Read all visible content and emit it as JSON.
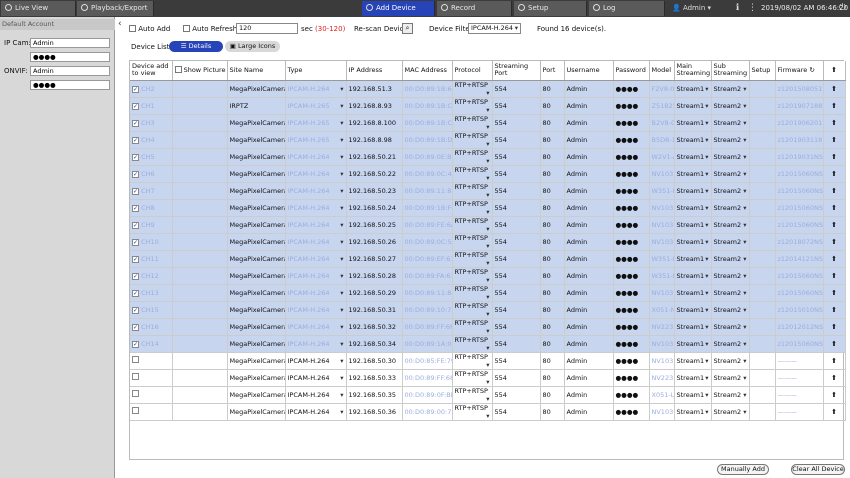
{
  "topbar": {
    "tabs": [
      {
        "label": "Live View",
        "icon": "monitor-icon"
      },
      {
        "label": "Playback/Export",
        "icon": "play-icon"
      },
      {
        "label": "Add Device",
        "icon": "plus-icon"
      },
      {
        "label": "Record",
        "icon": "record-icon"
      },
      {
        "label": "Setup",
        "icon": "gear-icon"
      },
      {
        "label": "Log",
        "icon": "log-icon"
      }
    ],
    "user": "Admin",
    "datetime": "2019/08/02 AM 06:46:20"
  },
  "sidebar": {
    "title": "Default Account",
    "ip_cam_label": "IP Cam:",
    "ip_cam_user": "Admin",
    "ip_cam_pass": "●●●●",
    "onvif_label": "ONVIF:",
    "onvif_user": "Admin",
    "onvif_pass": "●●●●"
  },
  "toolbar": {
    "auto_add": "Auto Add",
    "auto_refresh": "Auto Refresh",
    "refresh_value": "120",
    "refresh_unit": "sec",
    "refresh_range": "(30-120)",
    "rescan": "Re-scan Device",
    "device_filter_label": "Device Filter",
    "device_filter_value": "IPCAM-H.264",
    "found": "Found 16 device(s).",
    "device_list": "Device List",
    "details": "Details",
    "large_icons": "Large Icons"
  },
  "columns": [
    "Device add to view",
    "Show Picture",
    "Site Name",
    "Type",
    "IP Address",
    "MAC Address",
    "Protocol",
    "Streaming Port",
    "Port",
    "Username",
    "Password",
    "Model",
    "Main Streaming",
    "Sub Streaming",
    "Setup",
    "Firmware"
  ],
  "rows": [
    {
      "sel": true,
      "ch": "CH2",
      "site": "MegaPixelCamera",
      "type": "IPCAM-H.264",
      "ip": "192.168.51.3",
      "mac": "00:D0:89:1B:6E:0F",
      "proto": "RTP+RTSP",
      "sport": "554",
      "port": "80",
      "user": "Admin",
      "pass": "●●●●",
      "model": "F2V8-0",
      "main": "Stream1",
      "sub": "Stream2",
      "fw": "z12015080512"
    },
    {
      "sel": true,
      "ch": "CH1",
      "site": "IRPTZ",
      "type": "IPCAM-H.265",
      "ip": "192.168.8.93",
      "mac": "00:D0:89:1B:C6:15",
      "proto": "RTP+RTSP",
      "sport": "554",
      "port": "80",
      "user": "Admin",
      "pass": "●●●●",
      "model": "Z51B251",
      "main": "Stream1",
      "sub": "Stream2",
      "fw": "z12019071882"
    },
    {
      "sel": true,
      "ch": "CH3",
      "site": "MegaPixelCamera",
      "type": "IPCAM-H.265",
      "ip": "192.168.8.100",
      "mac": "00:D0:89:1B:C5:F0",
      "proto": "RTP+RTSP",
      "sport": "554",
      "port": "80",
      "user": "Admin",
      "pass": "●●●●",
      "model": "B2V8-05",
      "main": "Stream1",
      "sub": "Stream2",
      "fw": "z12019062012P"
    },
    {
      "sel": true,
      "ch": "CH4",
      "site": "MegaPixelCamera",
      "type": "IPCAM-H.265",
      "ip": "192.168.8.98",
      "mac": "00:D0:89:1B:D4:02",
      "proto": "RTP+RTSP",
      "sport": "554",
      "port": "80",
      "user": "Admin",
      "pass": "●●●●",
      "model": "B5D8-1",
      "main": "Stream1",
      "sub": "Stream2",
      "fw": "z12019031187"
    },
    {
      "sel": true,
      "ch": "CH5",
      "site": "MegaPixelCamera",
      "type": "IPCAM-H.264",
      "ip": "192.168.50.21",
      "mac": "00:D0:89:0E:B2:7E",
      "proto": "RTP+RTSP",
      "sport": "554",
      "port": "80",
      "user": "Admin",
      "pass": "●●●●",
      "model": "W2V1-A",
      "main": "Stream1",
      "sub": "Stream2",
      "fw": "z12019031NSA"
    },
    {
      "sel": true,
      "ch": "CH6",
      "site": "MegaPixelCamera",
      "type": "IPCAM-H.264",
      "ip": "192.168.50.22",
      "mac": "00:D0:89:0C:43:1F",
      "proto": "RTP+RTSP",
      "sport": "554",
      "port": "80",
      "user": "Admin",
      "pass": "●●●●",
      "model": "NV103",
      "main": "Stream1",
      "sub": "Stream2",
      "fw": "z12015060NSA"
    },
    {
      "sel": true,
      "ch": "CH7",
      "site": "MegaPixelCamera",
      "type": "IPCAM-H.264",
      "ip": "192.168.50.23",
      "mac": "00:D0:89:11:88:8A",
      "proto": "RTP+RTSP",
      "sport": "554",
      "port": "80",
      "user": "Admin",
      "pass": "●●●●",
      "model": "W351-L",
      "main": "Stream1",
      "sub": "Stream2",
      "fw": "z12015060NSA"
    },
    {
      "sel": true,
      "ch": "CH8",
      "site": "MegaPixelCamera",
      "type": "IPCAM-H.264",
      "ip": "192.168.50.24",
      "mac": "00:D0:89:1B:FC:D3",
      "proto": "RTP+RTSP",
      "sport": "554",
      "port": "80",
      "user": "Admin",
      "pass": "●●●●",
      "model": "NV103",
      "main": "Stream1",
      "sub": "Stream2",
      "fw": "z12015060NSA"
    },
    {
      "sel": true,
      "ch": "CH9",
      "site": "MegaPixelCamera",
      "type": "IPCAM-H.264",
      "ip": "192.168.50.25",
      "mac": "00:D0:89:FE:6A:54",
      "proto": "RTP+RTSP",
      "sport": "554",
      "port": "80",
      "user": "Admin",
      "pass": "●●●●",
      "model": "NV103",
      "main": "Stream1",
      "sub": "Stream2",
      "fw": "z12015060NSA"
    },
    {
      "sel": true,
      "ch": "CH10",
      "site": "MegaPixelCamera",
      "type": "IPCAM-H.264",
      "ip": "192.168.50.26",
      "mac": "00:D0:89:0C:55:C1",
      "proto": "RTP+RTSP",
      "sport": "554",
      "port": "80",
      "user": "Admin",
      "pass": "●●●●",
      "model": "NV103",
      "main": "Stream1",
      "sub": "Stream2",
      "fw": "z12018072NSA"
    },
    {
      "sel": true,
      "ch": "CH11",
      "site": "MegaPixelCamera",
      "type": "IPCAM-H.264",
      "ip": "192.168.50.27",
      "mac": "00:D0:89:EF:61:52",
      "proto": "RTP+RTSP",
      "sport": "554",
      "port": "80",
      "user": "Admin",
      "pass": "●●●●",
      "model": "W351-M",
      "main": "Stream1",
      "sub": "Stream2",
      "fw": "z12014121NSA"
    },
    {
      "sel": true,
      "ch": "CH12",
      "site": "MegaPixelCamera",
      "type": "IPCAM-H.264",
      "ip": "192.168.50.28",
      "mac": "00:D0:89:FA:61:E0",
      "proto": "RTP+RTSP",
      "sport": "554",
      "port": "80",
      "user": "Admin",
      "pass": "●●●●",
      "model": "W351-L",
      "main": "Stream1",
      "sub": "Stream2",
      "fw": "z12015060NSA"
    },
    {
      "sel": true,
      "ch": "CH13",
      "site": "MegaPixelCamera",
      "type": "IPCAM-H.264",
      "ip": "192.168.50.29",
      "mac": "00:D0:89:11:83:5F",
      "proto": "RTP+RTSP",
      "sport": "554",
      "port": "80",
      "user": "Admin",
      "pass": "●●●●",
      "model": "NV103",
      "main": "Stream1",
      "sub": "Stream2",
      "fw": "z12015060NSA"
    },
    {
      "sel": true,
      "ch": "CH15",
      "site": "MegaPixelCamera",
      "type": "IPCAM-H.264",
      "ip": "192.168.50.31",
      "mac": "00:D0:89:10:75:D9",
      "proto": "RTP+RTSP",
      "sport": "554",
      "port": "80",
      "user": "Admin",
      "pass": "●●●●",
      "model": "X051-M",
      "main": "Stream1",
      "sub": "Stream2",
      "fw": "z12015010NSX"
    },
    {
      "sel": true,
      "ch": "CH16",
      "site": "MegaPixelCamera",
      "type": "IPCAM-H.264",
      "ip": "192.168.50.32",
      "mac": "00:D0:89:FF:6F:F1",
      "proto": "RTP+RTSP",
      "sport": "554",
      "port": "80",
      "user": "Admin",
      "pass": "●●●●",
      "model": "NV223",
      "main": "Stream1",
      "sub": "Stream2",
      "fw": "z12012012NSA"
    },
    {
      "sel": true,
      "ch": "CH14",
      "site": "MegaPixelCamera",
      "type": "IPCAM-H.264",
      "ip": "192.168.50.34",
      "mac": "00:D0:89:1A:04:8A",
      "proto": "RTP+RTSP",
      "sport": "554",
      "port": "80",
      "user": "Admin",
      "pass": "●●●●",
      "model": "NV103",
      "main": "Stream1",
      "sub": "Stream2",
      "fw": "z12015060NSA"
    },
    {
      "sel": false,
      "ch": "",
      "site": "MegaPixelCamera",
      "type": "IPCAM-H.264",
      "ip": "192.168.50.30",
      "mac": "00:D0:85:FE:79:EB",
      "proto": "RTP+RTSP",
      "sport": "554",
      "port": "80",
      "user": "Admin",
      "pass": "●●●●",
      "model": "NV103",
      "main": "Stream1",
      "sub": "Stream2",
      "fw": "———"
    },
    {
      "sel": false,
      "ch": "",
      "site": "MegaPixelCamera",
      "type": "IPCAM-H.264",
      "ip": "192.168.50.33",
      "mac": "00:D0:89:FF:68:DF",
      "proto": "RTP+RTSP",
      "sport": "554",
      "port": "80",
      "user": "Admin",
      "pass": "●●●●",
      "model": "NV223",
      "main": "Stream1",
      "sub": "Stream2",
      "fw": "———"
    },
    {
      "sel": false,
      "ch": "",
      "site": "MegaPixelCamera",
      "type": "IPCAM-H.264",
      "ip": "192.168.50.35",
      "mac": "00:D0:89:0F:BD:F7",
      "proto": "RTP+RTSP",
      "sport": "554",
      "port": "80",
      "user": "Admin",
      "pass": "●●●●",
      "model": "X051-L",
      "main": "Stream1",
      "sub": "Stream2",
      "fw": "———"
    },
    {
      "sel": false,
      "ch": "",
      "site": "MegaPixelCamera",
      "type": "IPCAM-H.264",
      "ip": "192.168.50.36",
      "mac": "00:D0:89:00:7E:F4",
      "proto": "RTP+RTSP",
      "sport": "554",
      "port": "80",
      "user": "Admin",
      "pass": "●●●●",
      "model": "NV103",
      "main": "Stream1",
      "sub": "Stream2",
      "fw": "———"
    }
  ],
  "footer": {
    "manual_add": "Manually Add",
    "clear_all": "Clear All Device"
  },
  "colors": {
    "accent": "#2643b8",
    "selected_row": "#c8d5ef",
    "topbar": "#3b3b3b"
  }
}
